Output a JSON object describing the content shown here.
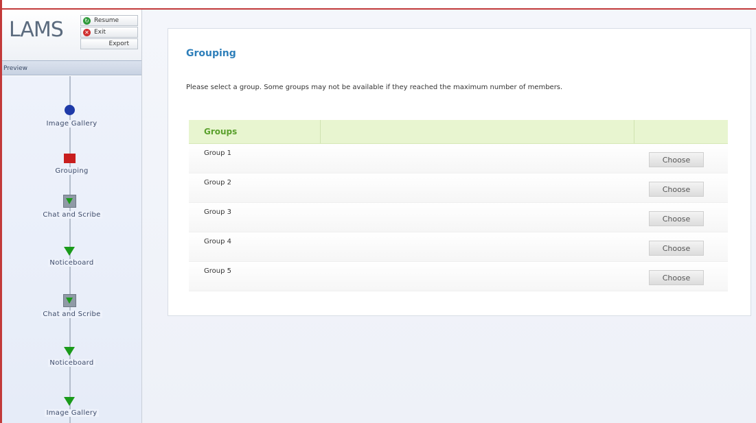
{
  "sidebar": {
    "logo": "LAMS",
    "resume_label": "Resume",
    "exit_label": "Exit",
    "export_label": "Export",
    "preview_label": "Preview",
    "activities": [
      {
        "label": "Image Gallery",
        "marker": "circle-blue"
      },
      {
        "label": "Grouping",
        "marker": "square-red"
      },
      {
        "label": "Chat and Scribe",
        "marker": "box-green-triangle"
      },
      {
        "label": "Noticeboard",
        "marker": "triangle-green"
      },
      {
        "label": "Chat and Scribe",
        "marker": "box-green-triangle"
      },
      {
        "label": "Noticeboard",
        "marker": "triangle-green"
      },
      {
        "label": "Image Gallery",
        "marker": "triangle-green"
      }
    ]
  },
  "main": {
    "title": "Grouping",
    "instructions": "Please select a group. Some groups may not be available if they reached the maximum number of members.",
    "table": {
      "header": "Groups",
      "rows": [
        {
          "name": "Group 1",
          "button": "Choose"
        },
        {
          "name": "Group 2",
          "button": "Choose"
        },
        {
          "name": "Group 3",
          "button": "Choose"
        },
        {
          "name": "Group 4",
          "button": "Choose"
        },
        {
          "name": "Group 5",
          "button": "Choose"
        }
      ]
    }
  },
  "colors": {
    "accent_title": "#2e7fba",
    "header_green": "#5aa02c",
    "frame_red": "#c23a3a"
  }
}
